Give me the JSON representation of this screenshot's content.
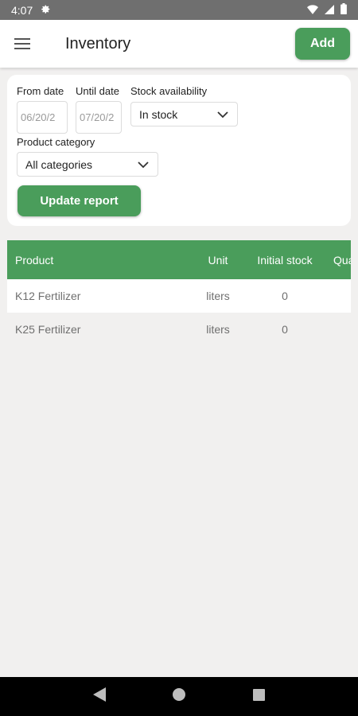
{
  "status_bar": {
    "time": "4:07",
    "icons": [
      "settings-icon",
      "wifi-icon",
      "signal-icon",
      "battery-icon"
    ]
  },
  "app_bar": {
    "title": "Inventory",
    "add_label": "Add",
    "menu_icon": "hamburger-menu-icon"
  },
  "filters": {
    "from_date": {
      "label": "From date",
      "value": "06/20/2"
    },
    "until_date": {
      "label": "Until date",
      "value": "07/20/2"
    },
    "stock_availability": {
      "label": "Stock availability",
      "value": "In stock"
    },
    "product_category": {
      "label": "Product category",
      "value": "All categories"
    },
    "update_label": "Update report"
  },
  "table": {
    "headers": [
      "Product",
      "Unit",
      "Initial stock",
      "Qua"
    ],
    "rows": [
      {
        "product": "K12 Fertilizer",
        "unit": "liters",
        "initial_stock": "0"
      },
      {
        "product": "K25 Fertilizer",
        "unit": "liters",
        "initial_stock": "0"
      }
    ]
  },
  "nav_bar": {
    "icons": [
      "back-icon",
      "home-icon",
      "recents-icon"
    ]
  },
  "colors": {
    "accent": "#4a9d5b",
    "status_bar": "#6f6f6f",
    "background": "#f1f0ef"
  }
}
